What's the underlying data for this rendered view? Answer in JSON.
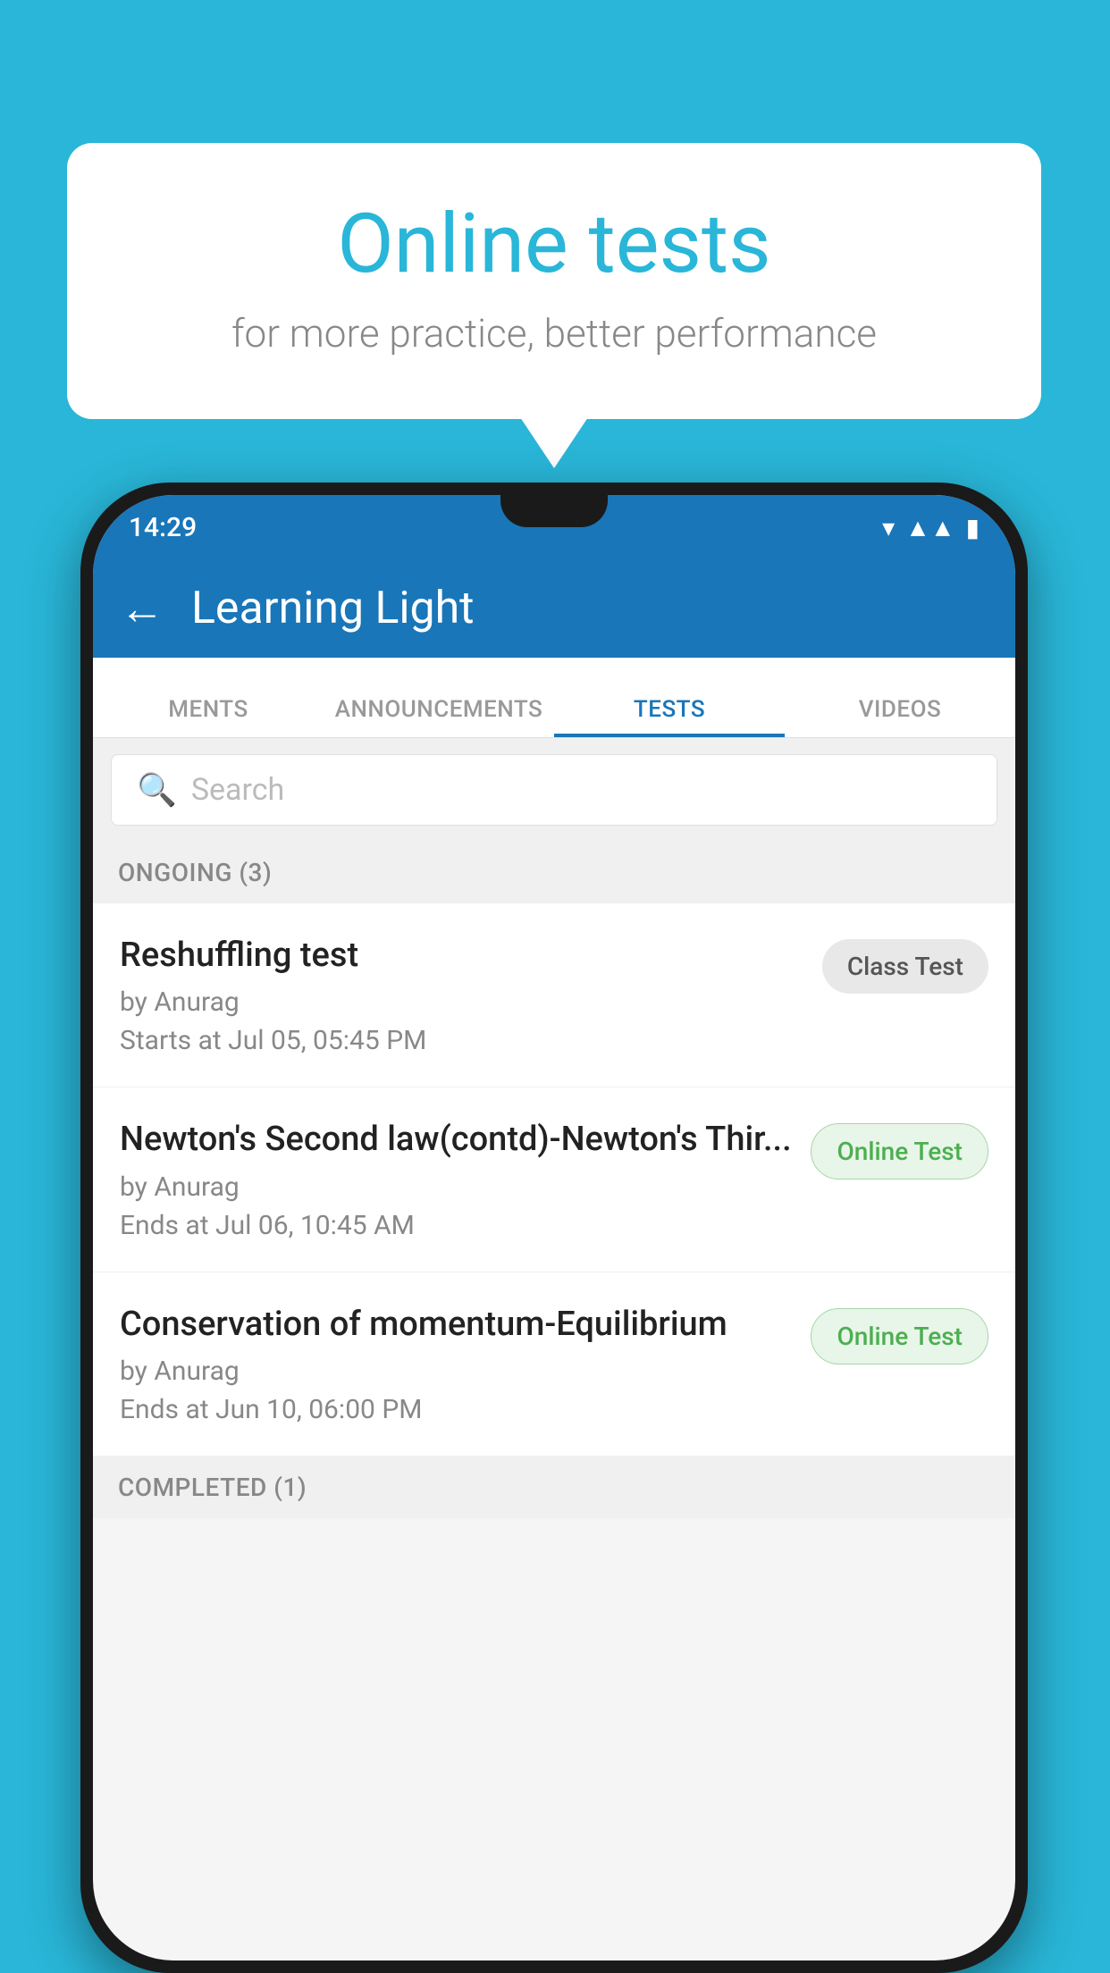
{
  "background": {
    "color": "#29b6d8"
  },
  "speech_bubble": {
    "title": "Online tests",
    "subtitle": "for more practice, better performance"
  },
  "phone": {
    "status_bar": {
      "time": "14:29"
    },
    "app_bar": {
      "title": "Learning Light",
      "back_label": "←"
    },
    "tabs": [
      {
        "label": "MENTS",
        "active": false
      },
      {
        "label": "ANNOUNCEMENTS",
        "active": false
      },
      {
        "label": "TESTS",
        "active": true
      },
      {
        "label": "VIDEOS",
        "active": false
      }
    ],
    "search": {
      "placeholder": "Search"
    },
    "section_ongoing": {
      "label": "ONGOING (3)"
    },
    "tests": [
      {
        "title": "Reshuffling test",
        "author": "by Anurag",
        "date": "Starts at  Jul 05, 05:45 PM",
        "badge": "Class Test",
        "badge_type": "class"
      },
      {
        "title": "Newton's Second law(contd)-Newton's Thir...",
        "author": "by Anurag",
        "date": "Ends at  Jul 06, 10:45 AM",
        "badge": "Online Test",
        "badge_type": "online"
      },
      {
        "title": "Conservation of momentum-Equilibrium",
        "author": "by Anurag",
        "date": "Ends at  Jun 10, 06:00 PM",
        "badge": "Online Test",
        "badge_type": "online"
      }
    ],
    "section_completed": {
      "label": "COMPLETED (1)"
    }
  }
}
